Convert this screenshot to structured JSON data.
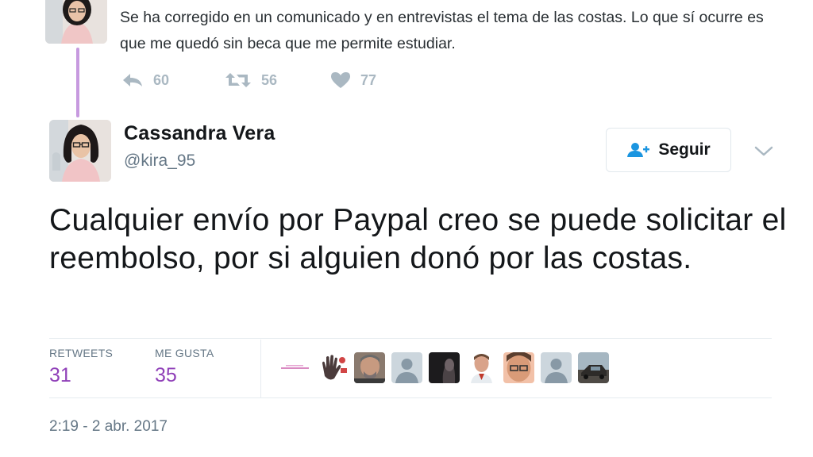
{
  "prev_tweet": {
    "text": "Se ha corregido en un comunicado y en entrevistas el tema de las costas. Lo que sí ocurre es que me quedó sin beca que me permite estudiar.",
    "replies": "60",
    "retweets": "56",
    "likes": "77"
  },
  "tweet": {
    "author_name": "Cassandra Vera",
    "author_handle": "@kira_95",
    "follow_label": "Seguir",
    "text": "Cualquier envío por Paypal creo se puede solicitar el reembolso, por si alguien donó por las costas.",
    "retweets_label": "RETWEETS",
    "retweets_count": "31",
    "likes_label": "ME GUSTA",
    "likes_count": "35",
    "timestamp": "2:19 - 2 abr. 2017"
  },
  "colors": {
    "accent_purple": "#8f3fb8",
    "thread_line": "#c79adf",
    "follow_icon": "#1b95e0",
    "muted": "#657786",
    "action_gray": "#aab8c2"
  },
  "icons": [
    "reply-icon",
    "retweet-icon",
    "heart-icon",
    "follow-person-icon",
    "chevron-down-icon"
  ]
}
